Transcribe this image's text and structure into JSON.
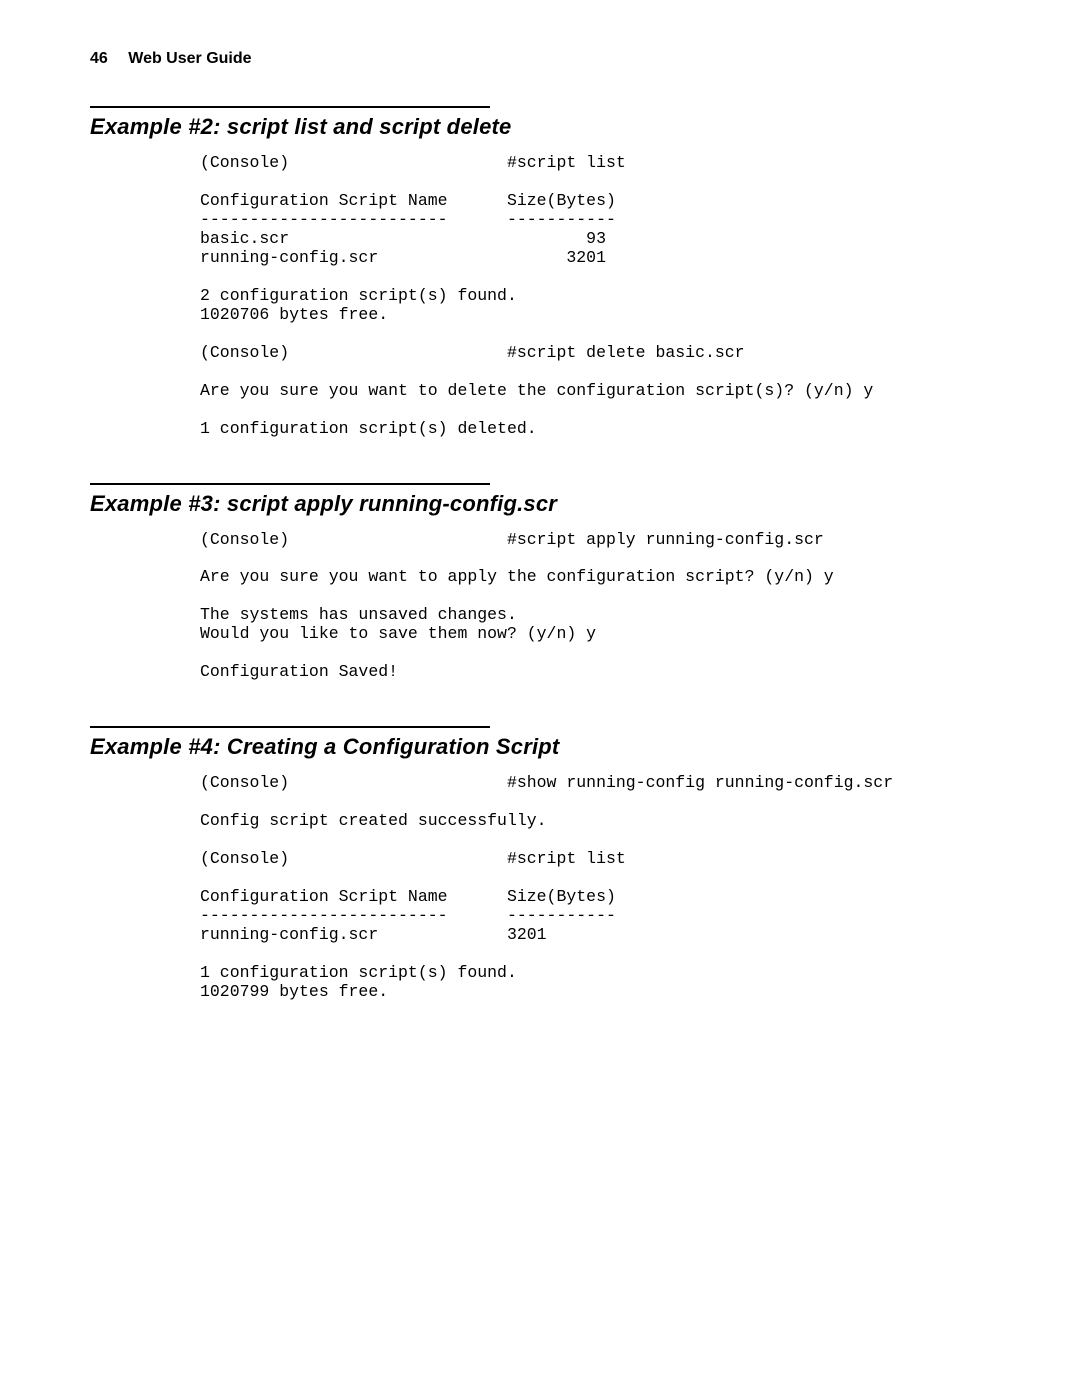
{
  "header": {
    "page_number": "46",
    "title": "Web User Guide"
  },
  "sections": [
    {
      "title": "Example #2: script list and script delete",
      "code": "(Console)                      #script list\n\nConfiguration Script Name      Size(Bytes)\n-------------------------      -----------\nbasic.scr                              93\nrunning-config.scr                   3201\n\n2 configuration script(s) found.\n1020706 bytes free.\n\n(Console)                      #script delete basic.scr\n\nAre you sure you want to delete the configuration script(s)? (y/n) y\n\n1 configuration script(s) deleted."
    },
    {
      "title": "Example #3: script apply running-config.scr",
      "code": "(Console)                      #script apply running-config.scr\n\nAre you sure you want to apply the configuration script? (y/n) y\n\nThe systems has unsaved changes.\nWould you like to save them now? (y/n) y\n\nConfiguration Saved!"
    },
    {
      "title": "Example #4: Creating a Configuration Script",
      "code": "(Console)                      #show running-config running-config.scr\n\nConfig script created successfully.\n\n(Console)                      #script list\n\nConfiguration Script Name      Size(Bytes)\n-------------------------      -----------\nrunning-config.scr             3201\n\n1 configuration script(s) found.\n1020799 bytes free."
    }
  ]
}
